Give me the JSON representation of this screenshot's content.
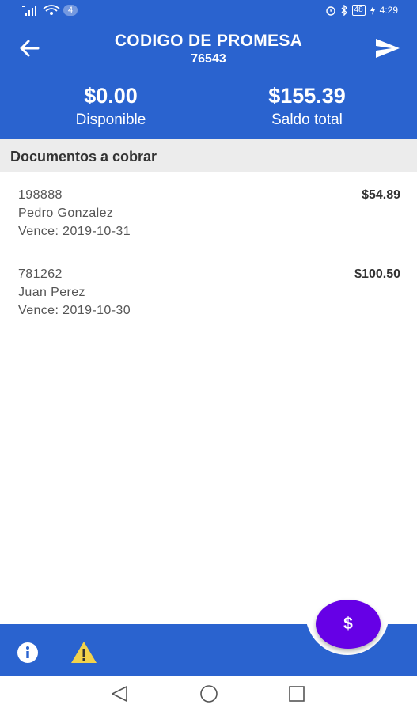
{
  "status_bar": {
    "notification_count": "4",
    "battery": "48",
    "time": "4:29",
    "icons": [
      "signal-icon",
      "wifi-icon",
      "alarm-icon",
      "bluetooth-icon",
      "battery-icon",
      "charging-icon"
    ]
  },
  "header": {
    "title": "CODIGO DE PROMESA",
    "code": "76543",
    "available": {
      "amount": "$0.00",
      "label": "Disponible"
    },
    "total": {
      "amount": "$155.39",
      "label": "Saldo total"
    },
    "icons": {
      "back": "arrow-left-icon",
      "send": "send-icon"
    }
  },
  "section": {
    "title": "Documentos a cobrar"
  },
  "documents": [
    {
      "number": "198888",
      "name": "Pedro Gonzalez",
      "due": "Vence: 2019-10-31",
      "amount": "$54.89"
    },
    {
      "number": "781262",
      "name": "Juan Perez",
      "due": "Vence: 2019-10-30",
      "amount": "$100.50"
    }
  ],
  "bottom_bar": {
    "fab_label": "$",
    "icons": [
      "info-icon",
      "warning-icon"
    ]
  },
  "nav_bar": {
    "icons": [
      "nav-back-icon",
      "nav-home-icon",
      "nav-recents-icon"
    ]
  },
  "colors": {
    "primary": "#2a63cf",
    "fab": "#6600e6",
    "warning": "#f2d24b"
  }
}
